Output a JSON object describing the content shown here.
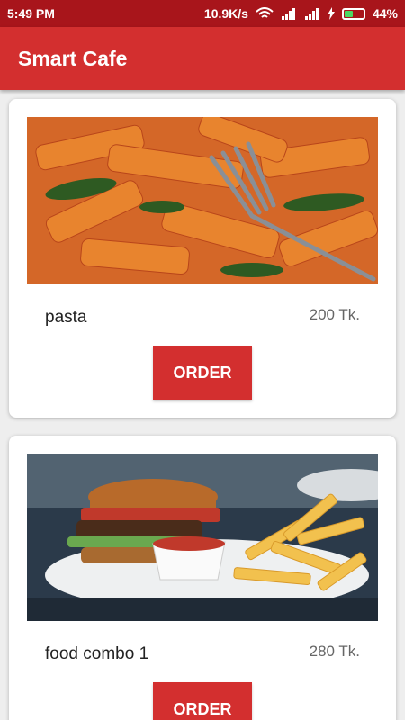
{
  "status_bar": {
    "time": "5:49 PM",
    "speed": "10.9K/s",
    "battery": "44%",
    "battery_level": 0.44,
    "icons": [
      "wifi-icon",
      "signal-icon",
      "signal-icon",
      "charging-icon",
      "battery-icon"
    ]
  },
  "app_bar": {
    "title": "Smart Cafe"
  },
  "items": [
    {
      "name": "pasta",
      "price": "200 Tk.",
      "button": "ORDER",
      "image": "pasta-image"
    },
    {
      "name": "food combo 1",
      "price": "280 Tk.",
      "button": "ORDER",
      "image": "burger-fries-image"
    }
  ],
  "colors": {
    "status_bar": "#a8151b",
    "app_bar": "#d32f2f",
    "button": "#d32f2f",
    "background": "#eeeeee"
  }
}
